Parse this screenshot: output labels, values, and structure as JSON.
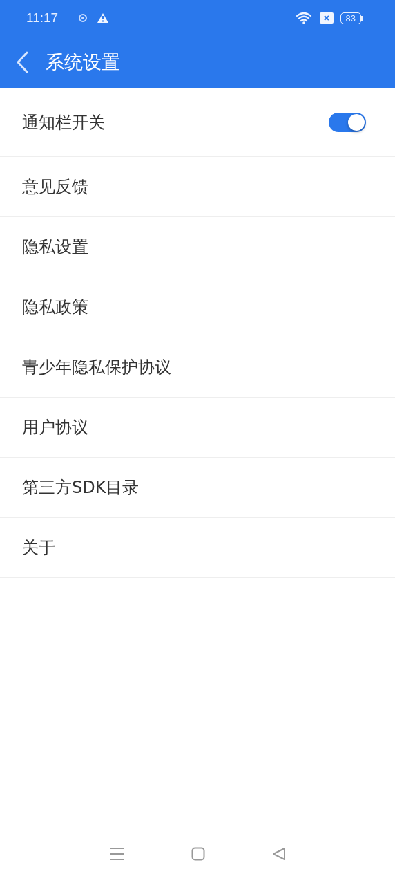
{
  "status_bar": {
    "time": "11:17",
    "battery": "83"
  },
  "header": {
    "title": "系统设置"
  },
  "items": [
    {
      "label": "通知栏开关",
      "kind": "toggle",
      "on": true
    },
    {
      "label": "意见反馈",
      "kind": "link"
    },
    {
      "label": "隐私设置",
      "kind": "link"
    },
    {
      "label": "隐私政策",
      "kind": "link"
    },
    {
      "label": "青少年隐私保护协议",
      "kind": "link"
    },
    {
      "label": "用户协议",
      "kind": "link"
    },
    {
      "label": "第三方SDK目录",
      "kind": "link"
    },
    {
      "label": "关于",
      "kind": "link"
    }
  ]
}
